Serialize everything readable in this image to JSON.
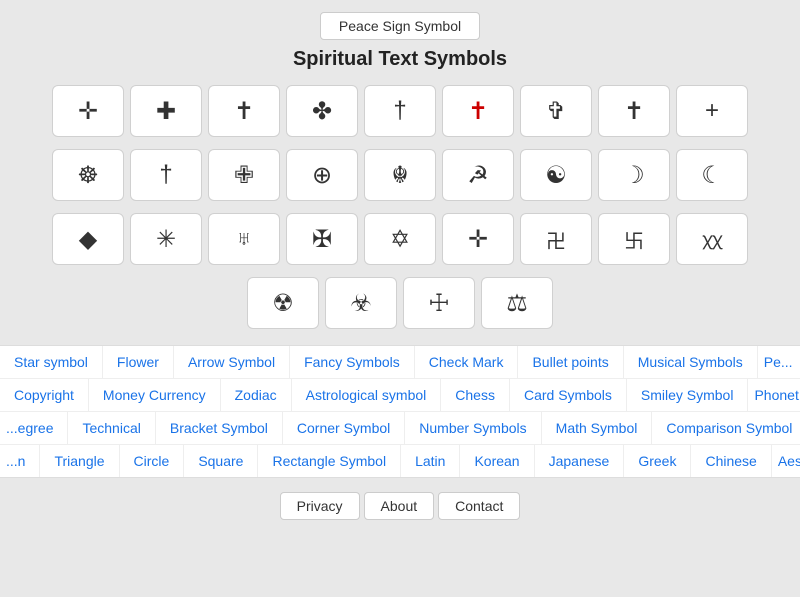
{
  "header": {
    "top_button": "Peace Sign Symbol",
    "title": "Spiritual Text Symbols"
  },
  "symbols": {
    "row1": [
      "✛",
      "✚",
      "✝",
      "✤",
      "†",
      "✝",
      "✞",
      "✝",
      "+"
    ],
    "row2": [
      "☸",
      "†",
      "✙",
      "⊕",
      "☬",
      "☭",
      "☯",
      "☽",
      "☾"
    ],
    "row3": [
      "◆",
      "✳",
      "⌥",
      "✠",
      "✡",
      "✛",
      "卍",
      "卐",
      "XX"
    ],
    "row4": [
      "☢",
      "☣",
      "☩",
      "⚖"
    ]
  },
  "nav_rows": {
    "row1": [
      "Star symbol",
      "Flower",
      "Arrow Symbol",
      "Fancy Symbols",
      "Check Mark",
      "Bullet points",
      "Musical Symbols",
      "Pe..."
    ],
    "row2": [
      "Copyright",
      "Money Currency",
      "Zodiac",
      "Astrological symbol",
      "Chess",
      "Card Symbols",
      "Smiley Symbol",
      "Phonet..."
    ],
    "row3": [
      "...egree",
      "Technical",
      "Bracket Symbol",
      "Corner Symbol",
      "Number Symbols",
      "Math Symbol",
      "Comparison Symbol"
    ],
    "row4": [
      "...n",
      "Triangle",
      "Circle",
      "Square",
      "Rectangle Symbol",
      "Latin",
      "Korean",
      "Japanese",
      "Greek",
      "Chinese",
      "Aesthet..."
    ]
  },
  "footer": {
    "privacy": "Privacy",
    "about": "About",
    "contact": "Contact"
  }
}
